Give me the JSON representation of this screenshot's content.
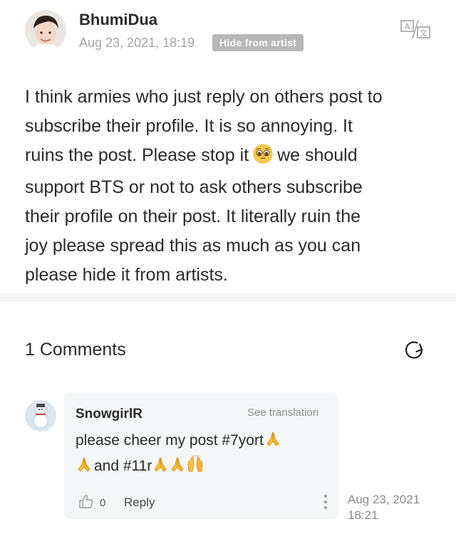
{
  "post": {
    "author": "BhumiDua",
    "date": "Aug 23, 2021, 18:19",
    "hide_badge": "Hide from artist",
    "body_lines": [
      "I think armies who just reply on others post to",
      "subscribe their profile. It is so annoying. It",
      "ruins the post. Please stop it",
      "we should",
      "support BTS or not to ask others subscribe",
      "their profile on their post. It literally ruin the",
      "joy please spread this as much as you can",
      "please hide it from artists."
    ]
  },
  "comments_section": {
    "title": "1 Comments"
  },
  "comment": {
    "author": "SnowgirlR",
    "see_translation": "See translation",
    "text_line1": "please cheer my post #7yort",
    "text_line2_mid": "and #11r",
    "like_count": "0",
    "reply_label": "Reply",
    "date_line1": "Aug 23, 2021",
    "date_line2": "18:21"
  },
  "icons": {
    "translate": "translate-icon",
    "refresh": "refresh-icon",
    "like": "thumbs-up-icon",
    "more": "more-vertical-icon",
    "pleading_face": "pleading-face-emoji",
    "folded_hands": "folded-hands-emoji",
    "raising_hands": "raising-hands-emoji"
  },
  "colors": {
    "badge_bg": "#b7b7b7",
    "muted_text": "#a3a3a3",
    "card_bg": "#f5f6f8",
    "divider": "#f4f4f4"
  }
}
